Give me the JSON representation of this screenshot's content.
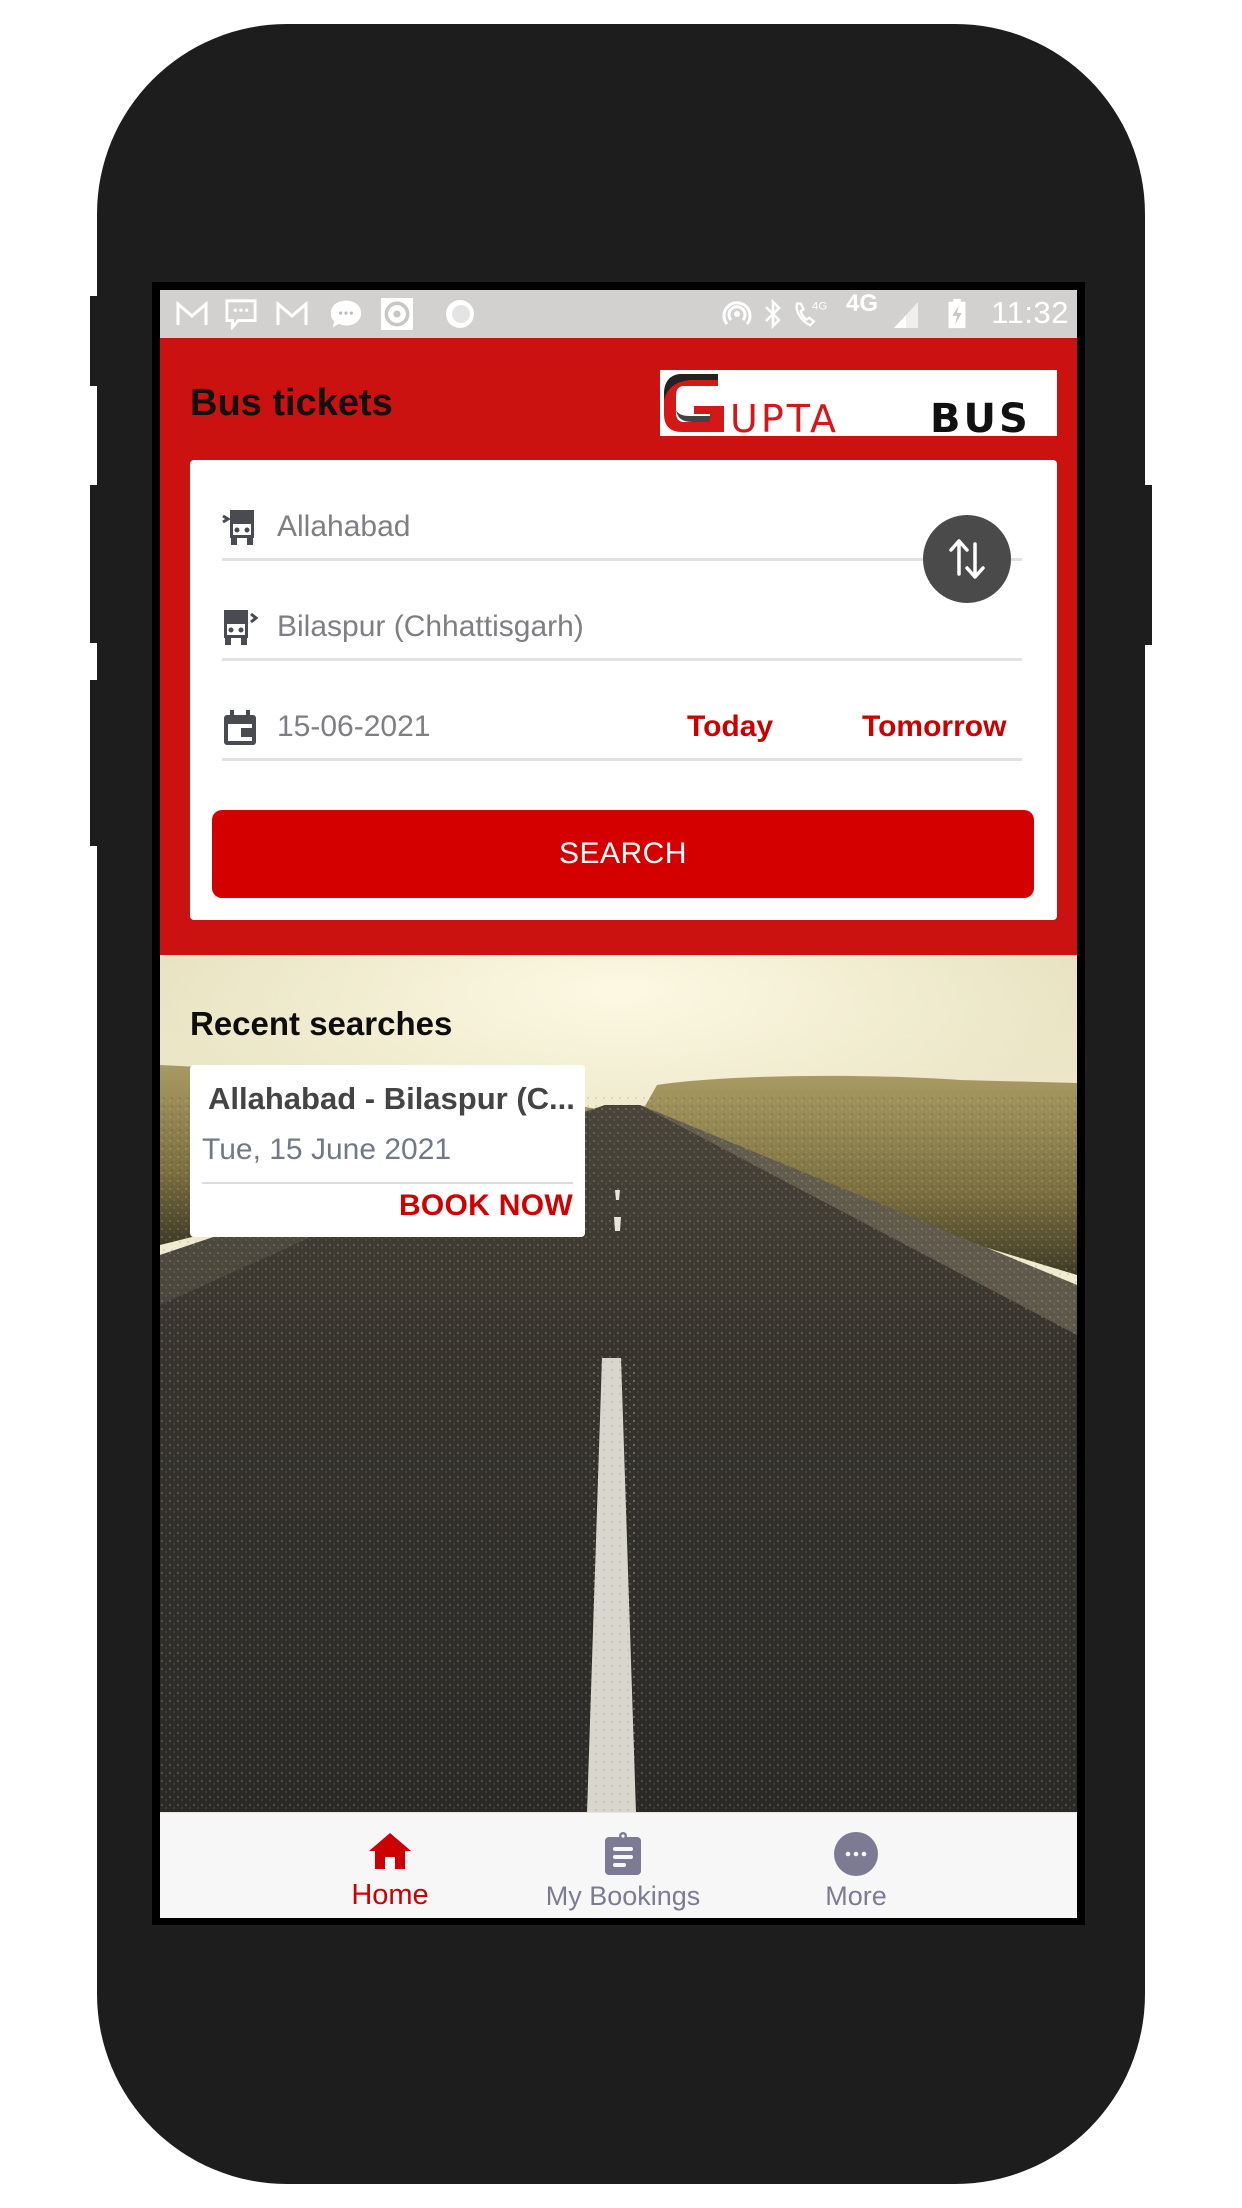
{
  "status_bar": {
    "left_icons": [
      "gmail-icon",
      "message-icon",
      "gmail-icon",
      "chat-bubble-icon",
      "record-icon",
      "circle-icon"
    ],
    "right_icons": [
      "hotspot-icon",
      "bluetooth-icon",
      "volte-call-icon",
      "network-4g-icon",
      "signal-icon",
      "battery-charging-icon"
    ],
    "volte_label": "4G",
    "network_label": "4G",
    "time": "11:32"
  },
  "header": {
    "title": "Bus tickets",
    "logo": {
      "text_main": "UPTA",
      "text_initial": "G",
      "text_suffix": "BUS"
    },
    "brand_color": "#cc1111"
  },
  "search_form": {
    "from": {
      "value": "Allahabad",
      "icon": "bus-departure-icon"
    },
    "to": {
      "value": "Bilaspur (Chhattisgarh)",
      "icon": "bus-arrival-icon"
    },
    "swap_icon": "swap-vertical-icon",
    "date": {
      "value": "15-06-2021",
      "icon": "calendar-icon"
    },
    "quick_dates": [
      "Today",
      "Tomorrow"
    ],
    "search_label": "SEARCH"
  },
  "recent_searches": {
    "title": "Recent searches",
    "items": [
      {
        "route": "Allahabad - Bilaspur (C...",
        "date": "Tue, 15 June 2021",
        "action": "BOOK NOW"
      }
    ]
  },
  "bottom_nav": {
    "items": [
      {
        "label": "Home",
        "icon": "home-icon",
        "active": true
      },
      {
        "label": "My Bookings",
        "icon": "clipboard-icon",
        "active": false
      },
      {
        "label": "More",
        "icon": "more-icon",
        "active": false
      }
    ],
    "active_color": "#cc0000",
    "inactive_color": "#7d7b94"
  }
}
